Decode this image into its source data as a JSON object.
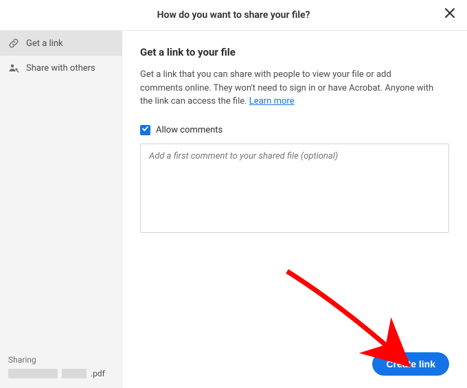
{
  "header": {
    "title": "How do you want to share your file?"
  },
  "sidebar": {
    "items": [
      {
        "label": "Get a link"
      },
      {
        "label": "Share with others"
      }
    ],
    "footer": {
      "sharing_label": "Sharing",
      "file_ext": ".pdf"
    }
  },
  "main": {
    "title": "Get a link to your file",
    "description": "Get a link that you can share with people to view your file or add comments online. They won't need to sign in or have Acrobat. Anyone with the link can access the file. ",
    "learn_more": "Learn more",
    "allow_comments_label": "Allow comments",
    "comment_placeholder": "Add a first comment to your shared file (optional)",
    "create_link_label": "Create link"
  },
  "colors": {
    "accent": "#1473e6"
  }
}
